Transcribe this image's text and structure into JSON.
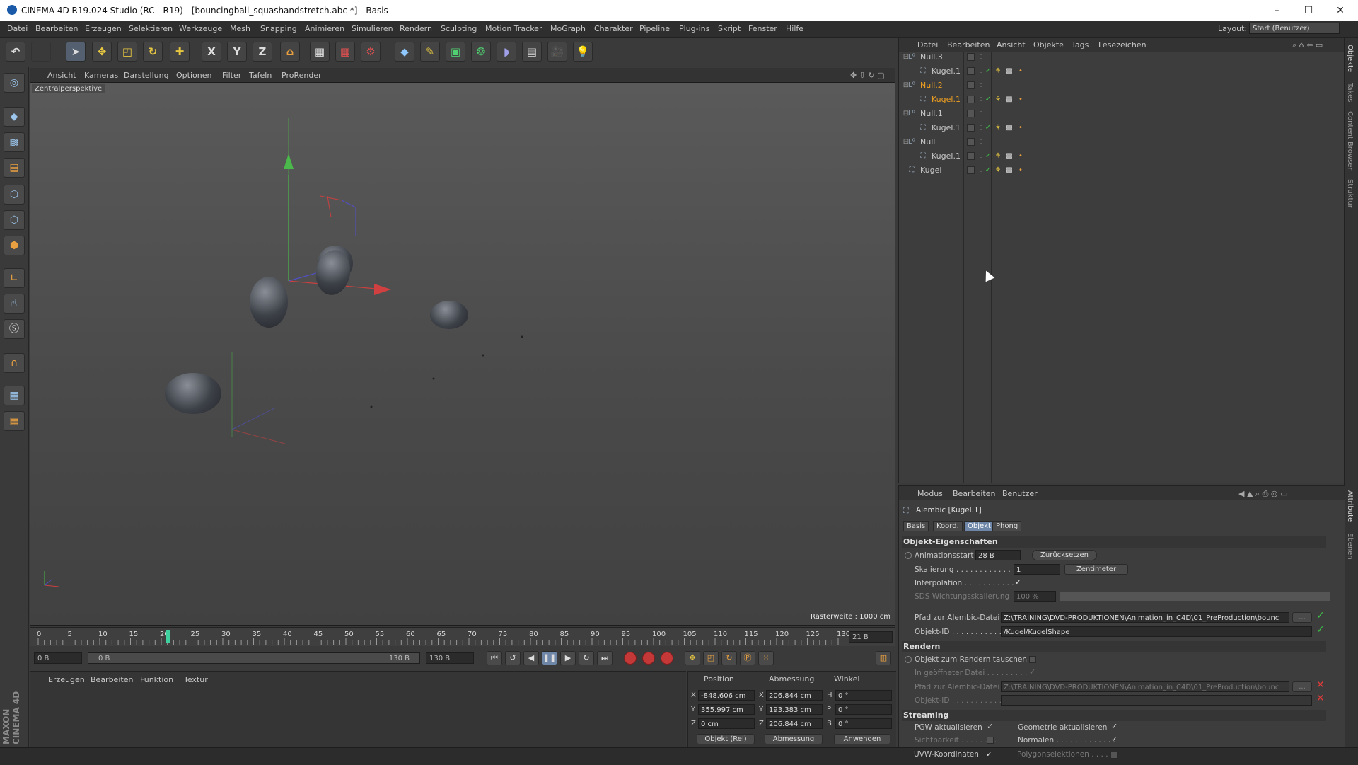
{
  "window": {
    "title": "CINEMA 4D R19.024 Studio (RC - R19) - [bouncingball_squashandstretch.abc *] - Basis",
    "minimize": "–",
    "maximize": "☐",
    "close": "✕"
  },
  "menu": [
    "Datei",
    "Bearbeiten",
    "Erzeugen",
    "Selektieren",
    "Werkzeuge",
    "Mesh",
    "Snapping",
    "Animieren",
    "Simulieren",
    "Rendern",
    "Sculpting",
    "Motion Tracker",
    "MoGraph",
    "Charakter",
    "Pipeline",
    "Plug-ins",
    "Skript",
    "Fenster",
    "Hilfe"
  ],
  "layout": {
    "label": "Layout:",
    "value": "Start (Benutzer)"
  },
  "toolbar": {
    "x": "X",
    "y": "Y",
    "z": "Z"
  },
  "viewport": {
    "menu": [
      "Ansicht",
      "Kameras",
      "Darstellung",
      "Optionen",
      "Filter",
      "Tafeln",
      "ProRender"
    ],
    "camera_label": "Zentralperspektive",
    "raster": "Rasterweite : 1000 cm"
  },
  "timeline": {
    "ticks": [
      "0",
      "5",
      "10",
      "15",
      "20",
      "25",
      "30",
      "35",
      "40",
      "45",
      "50",
      "55",
      "60",
      "65",
      "70",
      "75",
      "80",
      "85",
      "90",
      "95",
      "100",
      "105",
      "110",
      "115",
      "120",
      "125",
      "130"
    ],
    "current_frame": "21 B",
    "start": "0 B",
    "range_start": "0 B",
    "range_end": "130 B",
    "end": "130 B",
    "playhead_frame": 21
  },
  "material_manager": {
    "menu": [
      "Erzeugen",
      "Bearbeiten",
      "Funktion",
      "Textur"
    ]
  },
  "coordinates": {
    "headers": [
      "Position",
      "Abmessung",
      "Winkel"
    ],
    "rows": [
      {
        "axis": "X",
        "pos": "-848.606 cm",
        "dim_axis": "X",
        "dim": "206.844 cm",
        "rot_axis": "H",
        "rot": "0 °"
      },
      {
        "axis": "Y",
        "pos": "355.997 cm",
        "dim_axis": "Y",
        "dim": "193.383 cm",
        "rot_axis": "P",
        "rot": "0 °"
      },
      {
        "axis": "Z",
        "pos": "0 cm",
        "dim_axis": "Z",
        "dim": "206.844 cm",
        "rot_axis": "B",
        "rot": "0 °"
      }
    ],
    "mode": "Objekt (Rel)",
    "size_mode": "Abmessung",
    "apply": "Anwenden"
  },
  "brand": "MAXON CINEMA 4D",
  "object_manager": {
    "menu": [
      "Datei",
      "Bearbeiten",
      "Ansicht",
      "Objekte",
      "Tags",
      "Lesezeichen"
    ],
    "objects": [
      {
        "name": "Null.3",
        "type": "null",
        "selected": false,
        "child": false
      },
      {
        "name": "Kugel.1",
        "type": "alembic",
        "selected": false,
        "child": true
      },
      {
        "name": "Null.2",
        "type": "null",
        "selected": true,
        "child": false
      },
      {
        "name": "Kugel.1",
        "type": "alembic",
        "selected": true,
        "child": true
      },
      {
        "name": "Null.1",
        "type": "null",
        "selected": false,
        "child": false
      },
      {
        "name": "Kugel.1",
        "type": "alembic",
        "selected": false,
        "child": true
      },
      {
        "name": "Null",
        "type": "null",
        "selected": false,
        "child": false
      },
      {
        "name": "Kugel.1",
        "type": "alembic",
        "selected": false,
        "child": true
      },
      {
        "name": "Kugel",
        "type": "alembic",
        "selected": false,
        "child": false
      }
    ]
  },
  "side_tabs": [
    "Objekte",
    "Takes",
    "Content Browser",
    "Struktur"
  ],
  "side_tabs_lower": [
    "Attribute",
    "Ebenen"
  ],
  "attributes": {
    "menu": [
      "Modus",
      "Bearbeiten",
      "Benutzer"
    ],
    "title": "Alembic [Kugel.1]",
    "tabs": [
      "Basis",
      "Koord.",
      "Objekt",
      "Phong"
    ],
    "active_tab": "Objekt",
    "section1": "Objekt-Eigenschaften",
    "anim_start_label": "Animationsstart",
    "anim_start_value": "28 B",
    "reset": "Zurücksetzen",
    "scale_label": "Skalierung . . . . . . . . . . . . .",
    "scale_value": "1",
    "scale_unit": "Zentimeter",
    "interp_label": "Interpolation . . . . . . . . . . .",
    "sds_label": "SDS Wichtungsskalierung",
    "sds_value": "100 %",
    "path_label": "Pfad zur Alembic-Datei",
    "path_value": "Z:\\TRAINING\\DVD-PRODUKTIONEN\\Animation_in_C4D\\01_PreProduction\\bounc",
    "objid_label": "Objekt-ID . . . . . . . . . . . . . . .",
    "objid_value": "/Kugel/KugelShape",
    "section2": "Rendern",
    "swap_label": "Objekt zum Rendern tauschen",
    "in_open_label": "In geöffneter Datei . . . . . . . . .",
    "path2_label": "Pfad zur Alembic-Datei",
    "path2_value": "Z:\\TRAINING\\DVD-PRODUKTIONEN\\Animation_in_C4D\\01_PreProduction\\bounc",
    "objid2_label": "Objekt-ID . . . . . . . . . . . . . . .",
    "section3": "Streaming",
    "pgw_label": "PGW aktualisieren",
    "geo_label": "Geometrie aktualisieren",
    "vis_label": "Sichtbarkeit . . . . . . . .",
    "normals_label": "Normalen . . . . . . . . . . . . .",
    "uvw_label": "UVW-Koordinaten",
    "polysel_label": "Polygonselektionen . . . .",
    "check": "✓",
    "dots": "...",
    "cross": "✕"
  }
}
